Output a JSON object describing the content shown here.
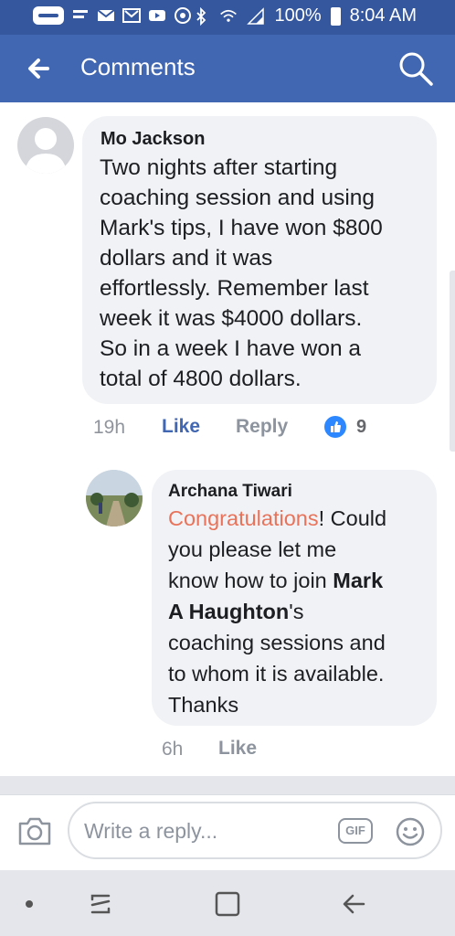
{
  "status_bar": {
    "battery": "100%",
    "time": "8:04 AM"
  },
  "app_bar": {
    "title": "Comments"
  },
  "comments": [
    {
      "author": "Mo Jackson",
      "lines": [
        "Two nights after starting",
        "coaching session and using",
        "Mark's tips, I have won $800",
        "dollars and it was",
        "effortlessly.  Remember last",
        "week it was $4000 dollars.",
        "So in a week I have won a",
        "total of 4800 dollars."
      ],
      "time": "19h",
      "like_label": "Like",
      "reply_label": "Reply",
      "reaction_count": "9"
    },
    {
      "author": "Archana Tiwari",
      "line1_highlight": "Congratulations",
      "line1_rest": "! Could",
      "line2": "you please let me",
      "line3_pre": "know how to join ",
      "line3_bold": "Mark",
      "line4_bold": "A Haughton",
      "line4_rest": "'s",
      "line5": "coaching sessions and",
      "line6": "to whom it is available.",
      "line7": "Thanks",
      "time": "6h",
      "like_label": "Like"
    }
  ],
  "composer": {
    "placeholder": "Write a reply...",
    "gif_label": "GIF"
  },
  "colors": {
    "brand": "#4267b2",
    "status_bar": "#35579d",
    "mention": "#e8735a",
    "like": "#4267b2"
  }
}
